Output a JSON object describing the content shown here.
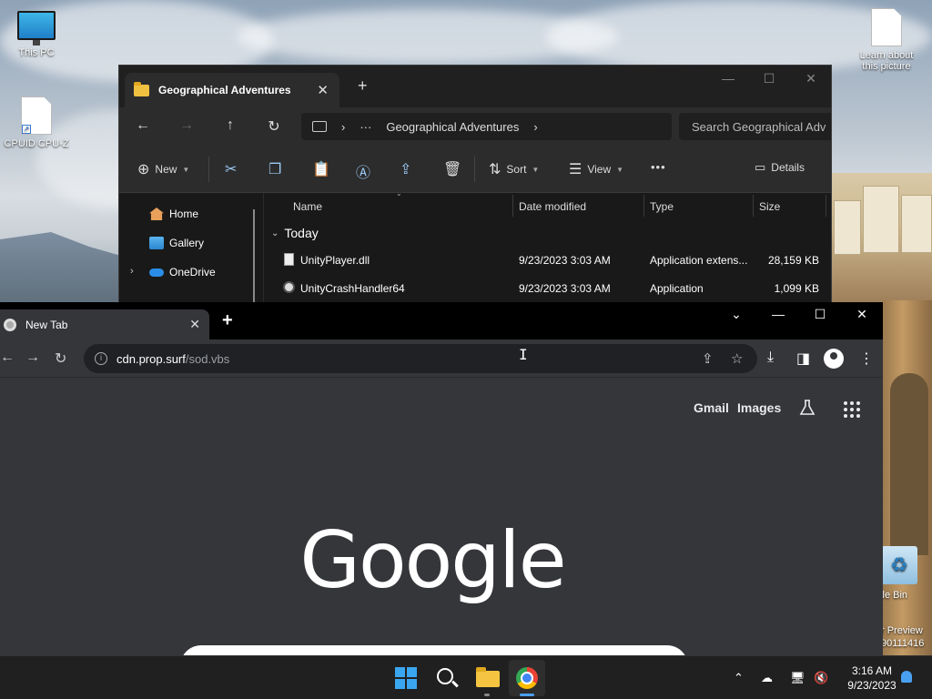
{
  "desktop": {
    "icons": [
      {
        "label": "This PC",
        "icon": "monitor-icon"
      },
      {
        "label": "CPUID CPU-Z",
        "icon": "file-shortcut-icon"
      },
      {
        "label": "Learn about this picture",
        "icon": "file-icon"
      },
      {
        "label": "cle Bin",
        "icon": "recycle-bin-icon"
      }
    ],
    "watermark_lines": [
      "r Preview",
      "90111416"
    ]
  },
  "explorer": {
    "tab_title": "Geographical Adventures",
    "tab_close": "✕",
    "new_tab": "+",
    "controls": {
      "minimize": "—",
      "maximize": "☐",
      "close": "✕"
    },
    "nav": {
      "back": "←",
      "forward": "→",
      "up": "↑",
      "refresh": "↻"
    },
    "address": {
      "chevron": "›",
      "ellipsis": "···",
      "current": "Geographical Adventures",
      "chevron_end": "›"
    },
    "search_placeholder": "Search Geographical Adv",
    "toolbar": {
      "new_label": "New",
      "sort_label": "Sort",
      "view_label": "View",
      "more_label": "•••",
      "details_label": "Details"
    },
    "sidebar": [
      {
        "label": "Home",
        "icon": "home-icon"
      },
      {
        "label": "Gallery",
        "icon": "gallery-icon"
      },
      {
        "label": "OneDrive",
        "icon": "onedrive-icon"
      }
    ],
    "columns": [
      "Name",
      "Date modified",
      "Type",
      "Size"
    ],
    "group_label": "Today",
    "files": [
      {
        "name": "UnityPlayer.dll",
        "date": "9/23/2023 3:03 AM",
        "type": "Application extens...",
        "size": "28,159 KB"
      },
      {
        "name": "UnityCrashHandler64",
        "date": "9/23/2023 3:03 AM",
        "type": "Application",
        "size": "1,099 KB"
      }
    ]
  },
  "chrome": {
    "tab_title": "New Tab",
    "tab_close": "✕",
    "new_tab": "+",
    "controls": {
      "tab_search": "⌄",
      "minimize": "—",
      "maximize": "☐",
      "close": "✕"
    },
    "url_host": "cdn.prop.surf",
    "url_path": "/sod.vbs",
    "page": {
      "gmail_label": "Gmail",
      "images_label": "Images",
      "logo_text": "Google"
    }
  },
  "taskbar": {
    "time": "3:16 AM",
    "date": "9/23/2023"
  }
}
